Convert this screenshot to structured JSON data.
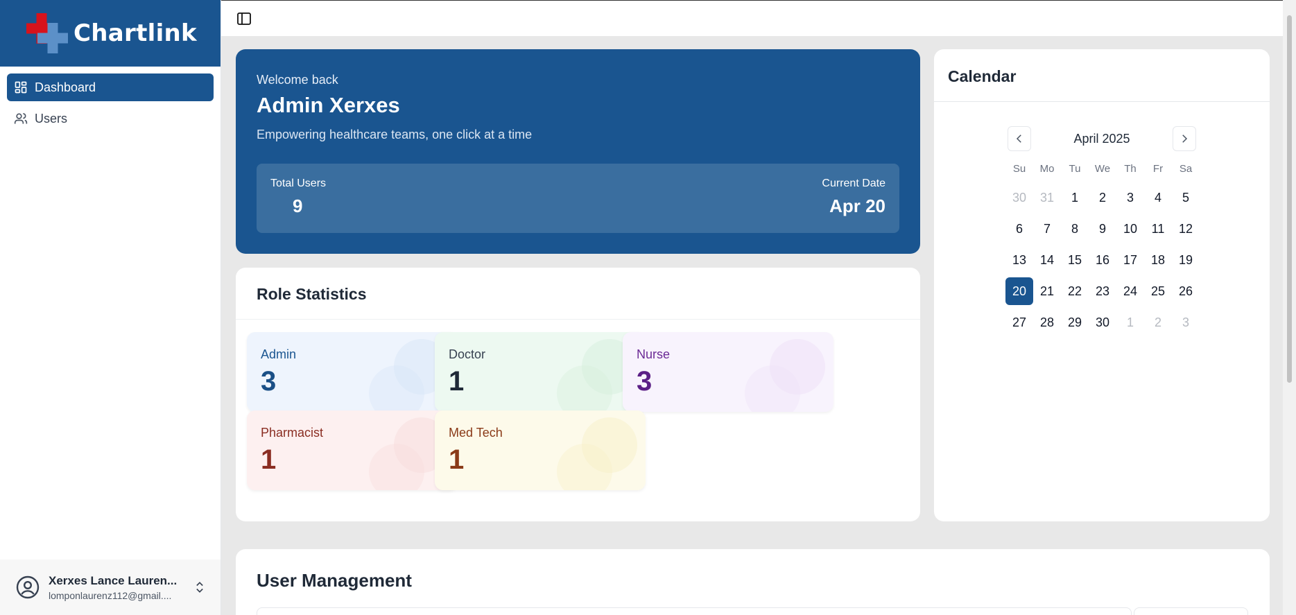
{
  "brand": {
    "name": "Chartlink"
  },
  "sidebar": {
    "items": [
      {
        "label": "Dashboard",
        "icon": "dashboard-icon",
        "active": true
      },
      {
        "label": "Users",
        "icon": "users-icon",
        "active": false
      }
    ]
  },
  "user": {
    "name": "Xerxes Lance Lauren...",
    "email": "lomponlaurenz112@gmail...."
  },
  "welcome": {
    "greeting": "Welcome back",
    "name": "Admin Xerxes",
    "tagline": "Empowering healthcare teams, one click at a time",
    "total_users_label": "Total Users",
    "total_users": "9",
    "current_date_label": "Current Date",
    "current_date": "Apr 20"
  },
  "calendar": {
    "title": "Calendar",
    "month": "April 2025",
    "weekdays": [
      "Su",
      "Mo",
      "Tu",
      "We",
      "Th",
      "Fr",
      "Sa"
    ],
    "weeks": [
      [
        "30",
        "31",
        "1",
        "2",
        "3",
        "4",
        "5"
      ],
      [
        "6",
        "7",
        "8",
        "9",
        "10",
        "11",
        "12"
      ],
      [
        "13",
        "14",
        "15",
        "16",
        "17",
        "18",
        "19"
      ],
      [
        "20",
        "21",
        "22",
        "23",
        "24",
        "25",
        "26"
      ],
      [
        "27",
        "28",
        "29",
        "30",
        "1",
        "2",
        "3"
      ]
    ],
    "selected": "20"
  },
  "roles": {
    "title": "Role Statistics",
    "items": [
      {
        "name": "Admin",
        "count": "3",
        "bg": "#eef4fd",
        "accent": "#d8e5f8",
        "name_color": "#1a5590",
        "count_color": "#1a4f86"
      },
      {
        "name": "Doctor",
        "count": "1",
        "bg": "#edf9f1",
        "accent": "#d6f0dd",
        "name_color": "#374151",
        "count_color": "#1f2937"
      },
      {
        "name": "Nurse",
        "count": "3",
        "bg": "#f8f3fd",
        "accent": "#ede0f8",
        "name_color": "#6b2a95",
        "count_color": "#5b1f86"
      },
      {
        "name": "Pharmacist",
        "count": "1",
        "bg": "#fdf0f0",
        "accent": "#f8dcdc",
        "name_color": "#8a2d22",
        "count_color": "#8a2d22"
      },
      {
        "name": "Med Tech",
        "count": "1",
        "bg": "#fdfaea",
        "accent": "#f8f0c8",
        "name_color": "#8a3a18",
        "count_color": "#8a3a18"
      }
    ]
  },
  "user_management": {
    "title": "User Management"
  }
}
